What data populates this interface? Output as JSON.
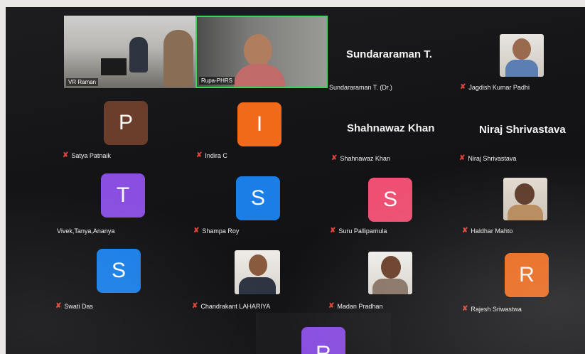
{
  "participants": {
    "vr_raman": {
      "label": "VR Raman"
    },
    "rupa": {
      "label": "Rupa-PHRS"
    },
    "sundararaman": {
      "display": "Sundararaman T.",
      "label": "Sundararaman T. (Dr.)"
    },
    "jagdish": {
      "label": "Jagdish Kumar Padhi"
    },
    "satya": {
      "initial": "P",
      "label": "Satya Patnaik",
      "color": "#6b3d2b"
    },
    "indira": {
      "initial": "I",
      "label": "Indira C",
      "color": "#f06a1a"
    },
    "shahnawaz": {
      "display": "Shahnawaz Khan",
      "label": "Shahnawaz Khan"
    },
    "niraj": {
      "display": "Niraj Shrivastava",
      "label": "Niraj Shrivastava"
    },
    "vivek": {
      "initial": "T",
      "label": "Vivek,Tanya,Ananya",
      "color": "#8a4fe0"
    },
    "shampa": {
      "initial": "S",
      "label": "Shampa Roy",
      "color": "#1a7ee6"
    },
    "suru": {
      "initial": "S",
      "label": "Suru Pallipamula",
      "color": "#ee4f72"
    },
    "haldhar": {
      "label": "Haldhar Mahto"
    },
    "swati": {
      "initial": "S",
      "label": "Swati Das",
      "color": "#1a7ee6"
    },
    "chandrakant": {
      "label": "Chandrakant LAHARIYA"
    },
    "madan": {
      "label": "Madan Pradhan"
    },
    "rajesh": {
      "initial": "R",
      "label": "Rajesh Sriwastwa",
      "color": "#f06a1a"
    },
    "extra": {
      "initial": "R",
      "color": "#8a4fe0"
    }
  },
  "icons": {
    "muted": "muted-mic-icon"
  },
  "colors": {
    "active_speaker_border": "#3fd35a",
    "muted": "#e0443a"
  }
}
